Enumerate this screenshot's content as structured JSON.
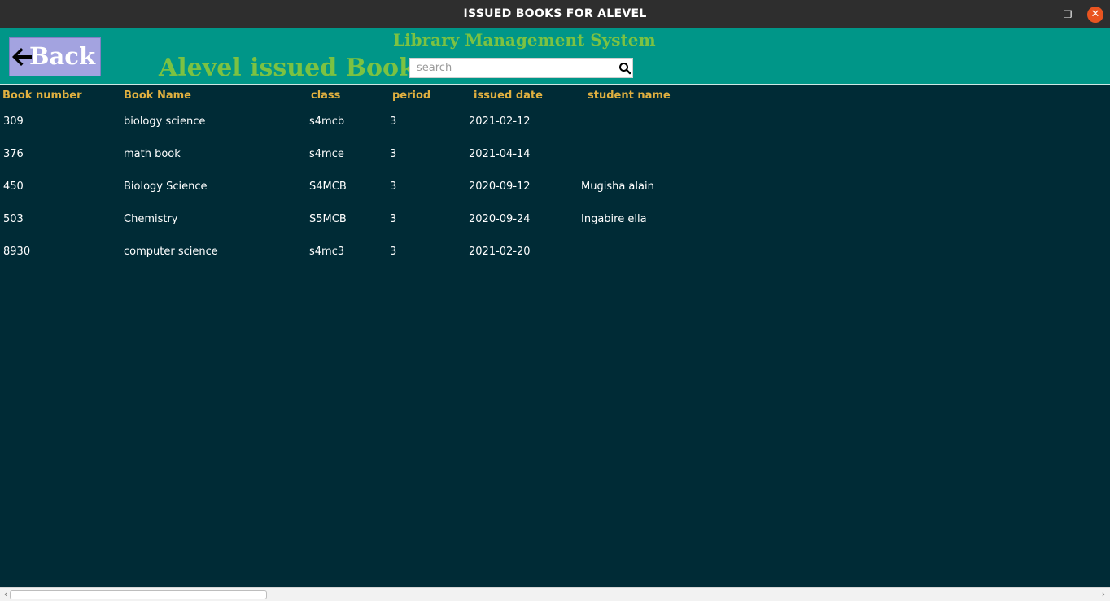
{
  "window": {
    "title": "ISSUED BOOKS FOR ALEVEL",
    "minimize_glyph": "–",
    "maximize_glyph": "❐",
    "close_glyph": "✕"
  },
  "header": {
    "back_label": "Back",
    "app_title": "Library Management System",
    "page_title": "Alevel issued Books",
    "search_placeholder": "search",
    "search_value": ""
  },
  "table": {
    "columns": [
      "Book number",
      "Book Name",
      "class",
      "period",
      "issued date",
      "student name"
    ],
    "rows": [
      [
        "309",
        "biology science",
        "s4mcb",
        "3",
        "2021-02-12",
        ""
      ],
      [
        "376",
        "math book",
        "s4mce",
        "3",
        "2021-04-14",
        ""
      ],
      [
        "450",
        "Biology Science",
        "S4MCB",
        "3",
        "2020-09-12",
        "Mugisha alain"
      ],
      [
        "503",
        "Chemistry",
        "S5MCB",
        "3",
        "2020-09-24",
        "Ingabire ella"
      ],
      [
        "8930",
        "computer science",
        "s4mc3",
        "3",
        "2021-02-20",
        ""
      ]
    ]
  },
  "scrollbar": {
    "left_arrow": "‹",
    "right_arrow": "›"
  },
  "colors": {
    "title_bar": "#2e2e2e",
    "header_bg": "#009688",
    "content_bg": "#002b36",
    "title_green": "#7cc242",
    "column_header": "#e0b040",
    "back_button": "#a3a3e0",
    "close_button": "#e95420"
  },
  "icons": {
    "back": "arrow-left-icon",
    "search": "search-icon",
    "minimize": "minimize-icon",
    "maximize": "maximize-icon",
    "close": "close-icon"
  }
}
